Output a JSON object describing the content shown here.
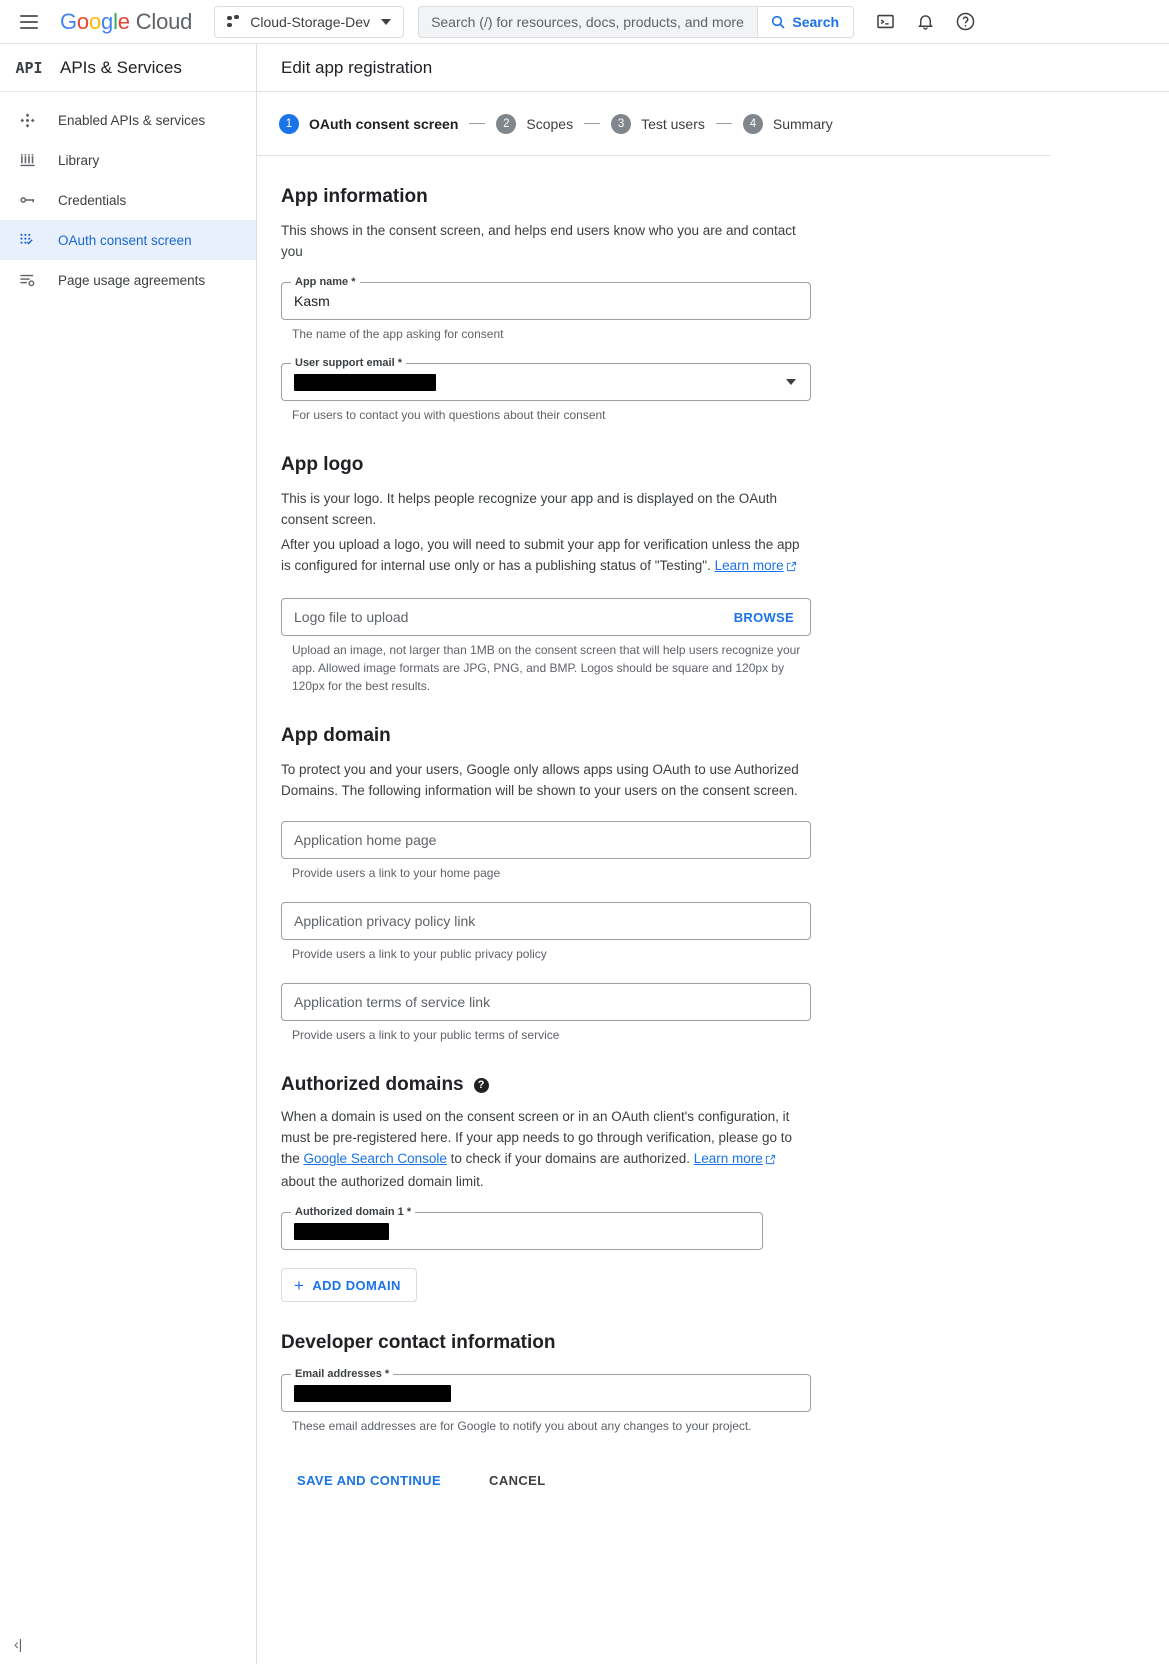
{
  "topbar": {
    "brand": {
      "g1": "G",
      "o1": "o",
      "o2": "o",
      "g2": "g",
      "l": "l",
      "e": "e",
      "cloud": "Cloud"
    },
    "project": "Cloud-Storage-Dev",
    "search_placeholder": "Search (/) for resources, docs, products, and more",
    "search_button": "Search",
    "icons": [
      "cloud-shell-icon",
      "notifications-bell-icon",
      "help-question-icon"
    ]
  },
  "sidebar": {
    "logo_text": "API",
    "title": "APIs & Services",
    "items": [
      {
        "label": "Enabled APIs & services",
        "icon": "enabled-apis-icon",
        "active": false
      },
      {
        "label": "Library",
        "icon": "library-icon",
        "active": false
      },
      {
        "label": "Credentials",
        "icon": "key-icon",
        "active": false
      },
      {
        "label": "OAuth consent screen",
        "icon": "oauth-consent-icon",
        "active": true
      },
      {
        "label": "Page usage agreements",
        "icon": "page-usage-icon",
        "active": false
      }
    ],
    "collapse_label": "‹|"
  },
  "page": {
    "title": "Edit app registration"
  },
  "stepper": [
    {
      "num": "1",
      "label": "OAuth consent screen",
      "current": true
    },
    {
      "num": "2",
      "label": "Scopes",
      "current": false
    },
    {
      "num": "3",
      "label": "Test users",
      "current": false
    },
    {
      "num": "4",
      "label": "Summary",
      "current": false
    }
  ],
  "app_information": {
    "heading": "App information",
    "description": "This shows in the consent screen, and helps end users know who you are and contact you",
    "app_name": {
      "label": "App name *",
      "value": "Kasm",
      "hint": "The name of the app asking for consent"
    },
    "user_support_email": {
      "label": "User support email *",
      "value": "",
      "hint": "For users to contact you with questions about their consent"
    }
  },
  "app_logo": {
    "heading": "App logo",
    "description_line1": "This is your logo. It helps people recognize your app and is displayed on the OAuth consent screen.",
    "description_line2_a": "After you upload a logo, you will need to submit your app for verification unless the app is configured for internal use only or has a publishing status of \"Testing\". ",
    "learn_more": "Learn more",
    "upload_placeholder": "Logo file to upload",
    "browse_label": "BROWSE",
    "hint": "Upload an image, not larger than 1MB on the consent screen that will help users recognize your app. Allowed image formats are JPG, PNG, and BMP. Logos should be square and 120px by 120px for the best results."
  },
  "app_domain": {
    "heading": "App domain",
    "description": "To protect you and your users, Google only allows apps using OAuth to use Authorized Domains. The following information will be shown to your users on the consent screen.",
    "fields": [
      {
        "placeholder": "Application home page",
        "hint": "Provide users a link to your home page"
      },
      {
        "placeholder": "Application privacy policy link",
        "hint": "Provide users a link to your public privacy policy"
      },
      {
        "placeholder": "Application terms of service link",
        "hint": "Provide users a link to your public terms of service"
      }
    ]
  },
  "authorized_domains": {
    "heading": "Authorized domains",
    "help_icon": "?",
    "para_a": "When a domain is used on the consent screen or in an OAuth client's configuration, it must be pre-registered here. If your app needs to go through verification, please go to the ",
    "link_console": "Google Search Console",
    "para_b": " to check if your domains are authorized. ",
    "link_learn_more": "Learn more",
    "para_c": " about the authorized domain limit.",
    "domain_label": "Authorized domain 1 *",
    "domain_value": "",
    "add_domain_label": "ADD DOMAIN"
  },
  "developer_contact": {
    "heading": "Developer contact information",
    "email_label": "Email addresses *",
    "email_value": "",
    "hint": "These email addresses are for Google to notify you about any changes to your project."
  },
  "footer_actions": {
    "save": "SAVE AND CONTINUE",
    "cancel": "CANCEL"
  },
  "colors": {
    "accent": "#1a73e8",
    "active_bg": "#e8f0fe",
    "border": "#dadce0"
  }
}
